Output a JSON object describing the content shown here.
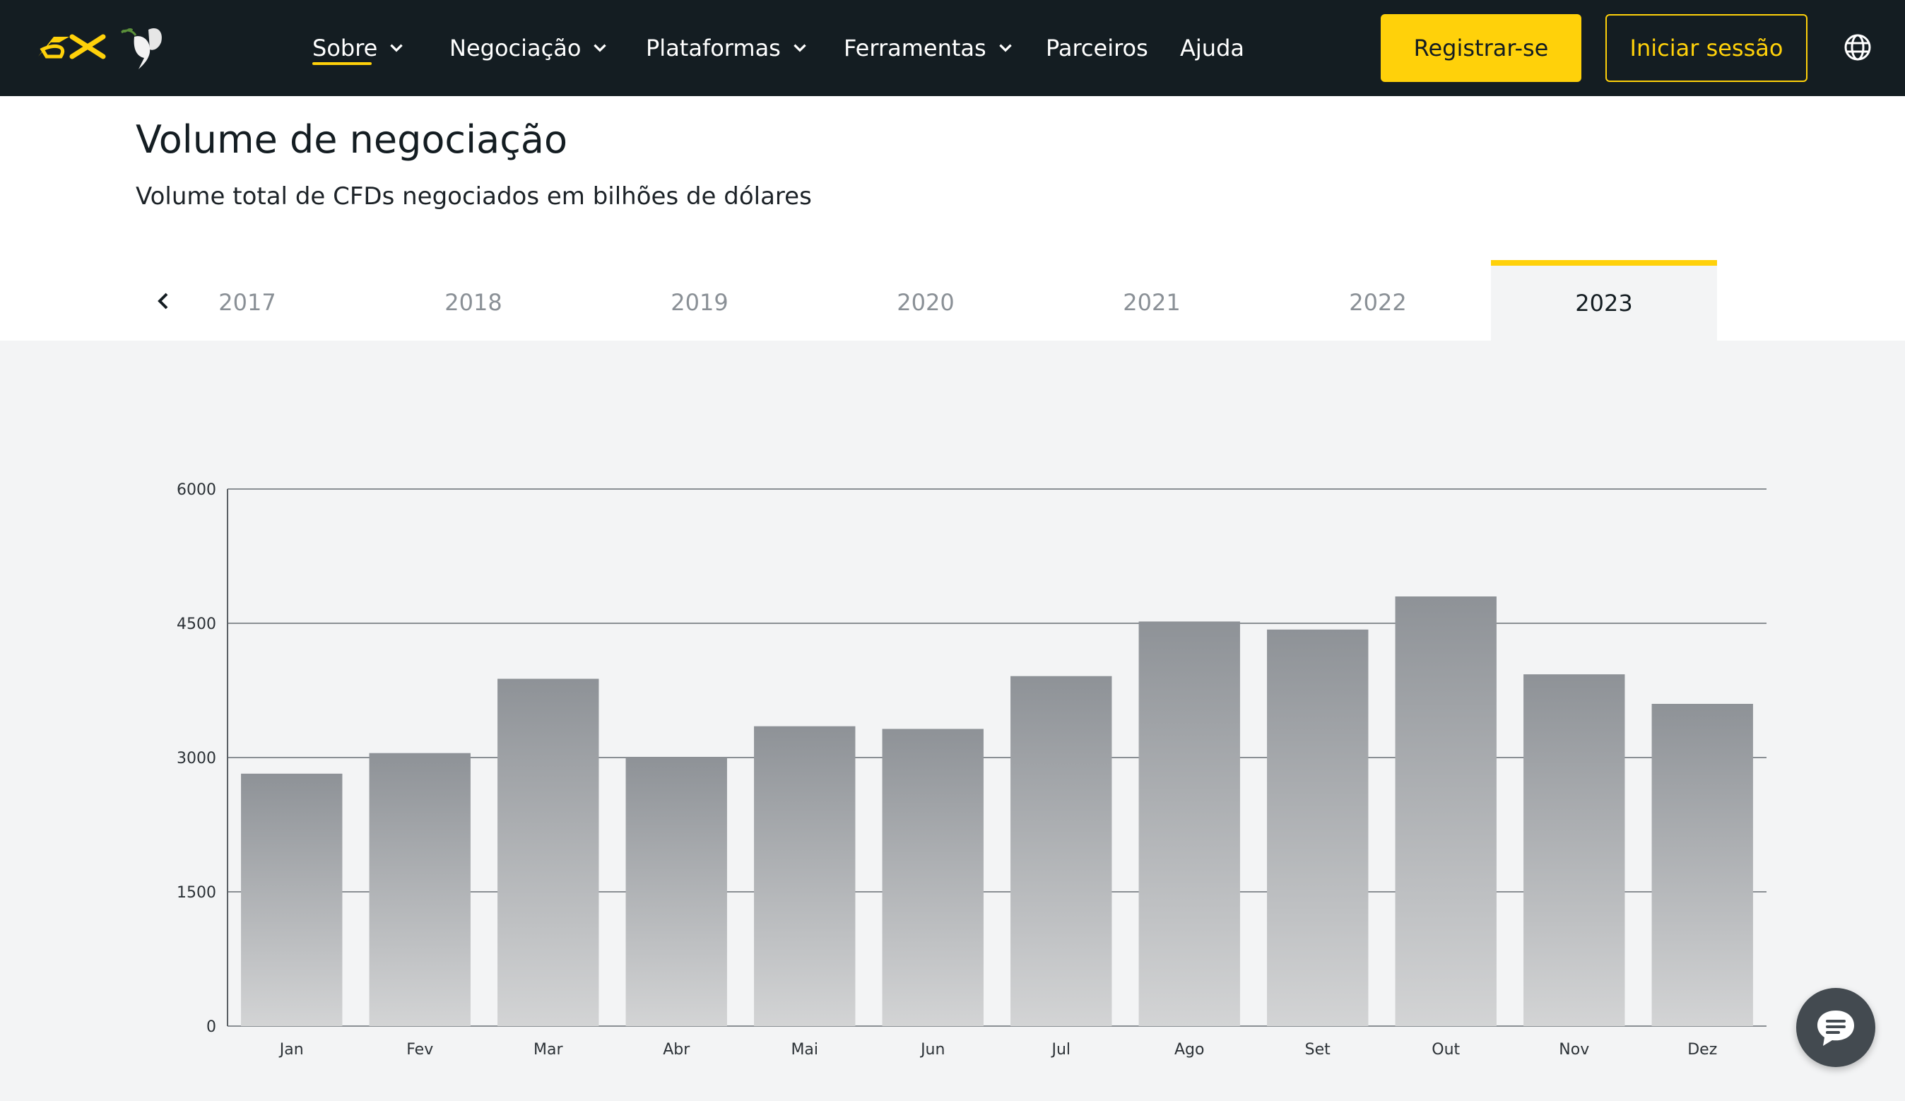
{
  "nav": {
    "items": [
      {
        "label": "Sobre",
        "has_dropdown": true,
        "active": true
      },
      {
        "label": "Negociação",
        "has_dropdown": true
      },
      {
        "label": "Plataformas",
        "has_dropdown": true
      },
      {
        "label": "Ferramentas",
        "has_dropdown": true
      },
      {
        "label": "Parceiros",
        "has_dropdown": false
      },
      {
        "label": "Ajuda",
        "has_dropdown": false
      }
    ],
    "register_label": "Registrar-se",
    "login_label": "Iniciar sessão",
    "icons": {
      "logo": "exness-logo-icon",
      "dove": "dove-icon",
      "language": "globe-icon"
    },
    "colors": {
      "background": "#141d22",
      "accent": "#ffd10a"
    }
  },
  "page": {
    "title": "Volume de negociação",
    "subtitle": "Volume total de CFDs negociados em bilhões de dólares"
  },
  "year_tabs": {
    "years": [
      "2017",
      "2018",
      "2019",
      "2020",
      "2021",
      "2022",
      "2023"
    ],
    "selected": "2023"
  },
  "chart_data": {
    "type": "bar",
    "categories": [
      "Jan",
      "Fev",
      "Mar",
      "Abr",
      "Mai",
      "Jun",
      "Jul",
      "Ago",
      "Set",
      "Out",
      "Nov",
      "Dez"
    ],
    "values": [
      2820,
      3050,
      3880,
      3000,
      3350,
      3320,
      3910,
      4520,
      4430,
      4800,
      3930,
      3600
    ],
    "ylim": [
      0,
      6000
    ],
    "yticks": [
      0,
      1500,
      3000,
      4500,
      6000
    ],
    "xlabel": "",
    "ylabel": "",
    "grid": true,
    "bar_color_top": "#8e9297",
    "bar_color_bottom": "#d3d4d5"
  },
  "chat": {
    "icon": "chat-bubble-icon"
  }
}
